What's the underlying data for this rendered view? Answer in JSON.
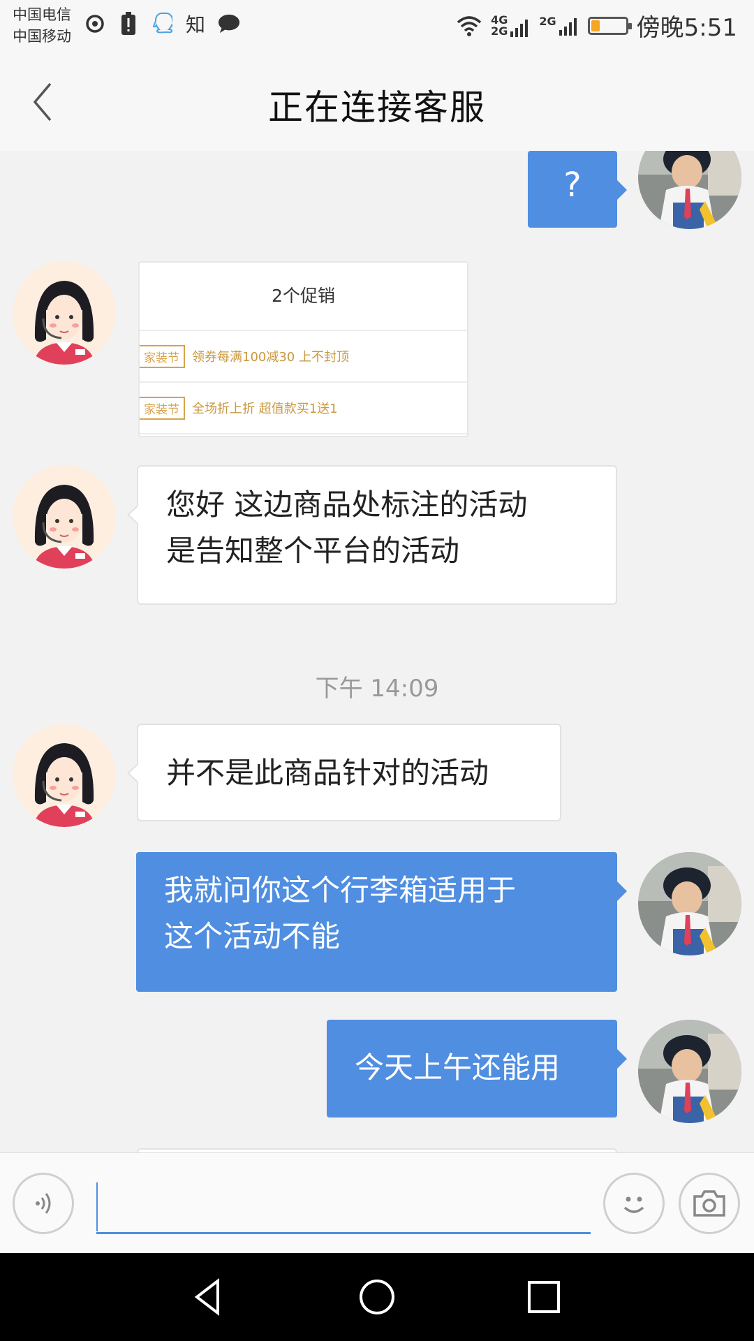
{
  "status_bar": {
    "carrier_1": "中国电信",
    "carrier_2": "中国移动",
    "icons": [
      "netease-music-icon",
      "battery-alert-icon",
      "qq-icon",
      "zhihu-icon",
      "chat-bubble-icon"
    ],
    "zhihu_label": "知",
    "network_1": "4G",
    "network_1b": "2G",
    "network_2": "2G",
    "time": "傍晚5:51",
    "battery_level": 0.2,
    "battery_color": "#f5a623"
  },
  "header": {
    "title": "正在连接客服"
  },
  "messages": [
    {
      "from": "user",
      "text": "?"
    },
    {
      "from": "agent",
      "type": "image",
      "promo": {
        "title": "2个促销",
        "rows": [
          {
            "tag": "家装节",
            "text": "领券每满100减30 上不封顶"
          },
          {
            "tag": "家装节",
            "text": "全场折上折 超值款买1送1"
          }
        ]
      }
    },
    {
      "from": "agent",
      "text_line1": "您好 这边商品处标注的活动",
      "text_line2": "是告知整个平台的活动"
    },
    {
      "type": "timestamp",
      "text": "下午 14:09"
    },
    {
      "from": "agent",
      "text": "并不是此商品针对的活动"
    },
    {
      "from": "user",
      "text_line1": "我就问你这个行李箱适用于",
      "text_line2": "这个活动不能"
    },
    {
      "from": "user",
      "text": "今天上午还能用"
    }
  ],
  "input_bar": {
    "placeholder": "",
    "value": ""
  },
  "colors": {
    "accent": "#4f8ee1",
    "chat_bg": "#f2f2f2",
    "bubble_in": "#ffffff"
  }
}
